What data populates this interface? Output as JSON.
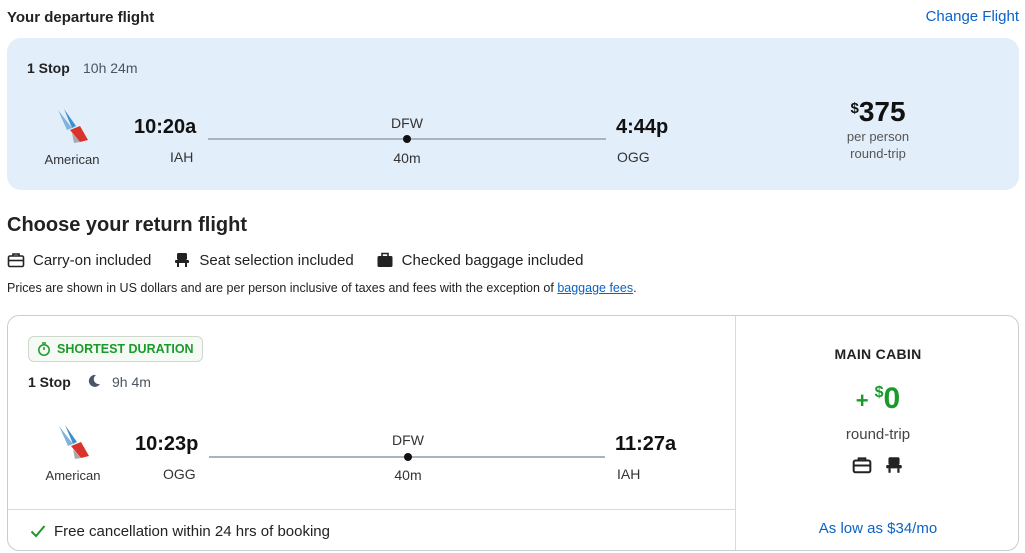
{
  "header": {
    "title": "Your departure flight",
    "change_link": "Change Flight"
  },
  "departure": {
    "stops": "1 Stop",
    "duration": "10h 24m",
    "airline": "American",
    "depart_time": "10:20a",
    "depart_code": "IAH",
    "via": "DFW",
    "layover": "40m",
    "arrive_time": "4:44p",
    "arrive_code": "OGG",
    "price_currency": "$",
    "price": "375",
    "price_per": "per person",
    "price_trip": "round-trip"
  },
  "return_section": {
    "title": "Choose your return flight",
    "inclusions": [
      "Carry-on included",
      "Seat selection included",
      "Checked baggage included"
    ],
    "note_text": "Prices are shown in US dollars and are per person inclusive of taxes and fees with the exception of ",
    "note_link": "baggage fees",
    "note_end": "."
  },
  "return_flight": {
    "badge": "SHORTEST DURATION",
    "stops": "1 Stop",
    "duration": "9h 4m",
    "airline": "American",
    "depart_time": "10:23p",
    "depart_code": "OGG",
    "via": "DFW",
    "layover": "40m",
    "arrive_time": "11:27a",
    "arrive_code": "IAH",
    "cancellation": "Free cancellation within 24 hrs of booking",
    "cabin": "MAIN CABIN",
    "plus": "+",
    "price_currency": "$",
    "price": "0",
    "price_trip": "round-trip",
    "financing": "As low as $34/mo"
  },
  "icons": {
    "airline_logo": "american-airlines-logo-icon",
    "carry_on": "carry-on-bag-icon",
    "seat": "seat-icon",
    "checked_bag": "checked-bag-icon",
    "stopwatch": "stopwatch-icon",
    "moon": "moon-icon",
    "check": "checkmark-icon"
  },
  "colors": {
    "link": "#0b63c5",
    "green": "#1a9a2b",
    "departure_card_bg": "#e3eefb"
  }
}
